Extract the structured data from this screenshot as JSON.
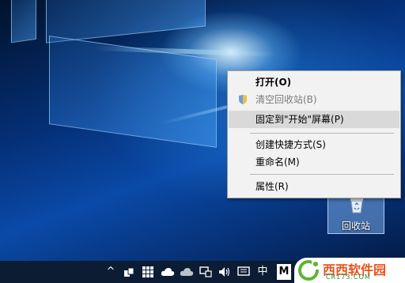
{
  "desktop": {
    "recycle_bin_label": "回收站"
  },
  "context_menu": {
    "items": [
      {
        "label": "打开(O)",
        "state": "default-bold"
      },
      {
        "label": "清空回收站(B)",
        "state": "disabled",
        "icon": "shield-icon"
      },
      {
        "label": "固定到\"开始\"屏幕(P)",
        "state": "highlighted"
      },
      {
        "label": "创建快捷方式(S)",
        "state": "normal"
      },
      {
        "label": "重命名(M)",
        "state": "normal"
      },
      {
        "label": "属性(R)",
        "state": "normal"
      }
    ]
  },
  "taskbar": {
    "chevron": "^",
    "ime_mode": "中",
    "ime_letter": "M",
    "icons": [
      "chevron-up-icon",
      "people-icon",
      "grid-icon",
      "cloud-icon",
      "cloud-gray-icon",
      "network-icon",
      "volume-icon",
      "notification-icon"
    ]
  },
  "watermark": {
    "brand": "西西软件园",
    "url": "CR173.COM"
  },
  "colors": {
    "menu_bg": "#f2f2f2",
    "highlight": "#d9d9d9",
    "taskbar": "#0b1c33"
  }
}
